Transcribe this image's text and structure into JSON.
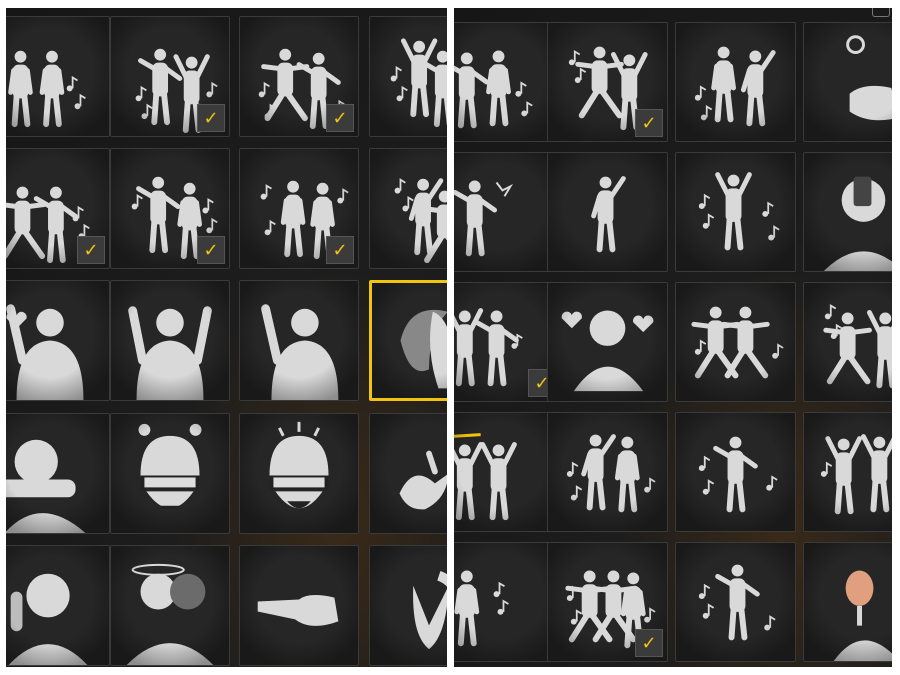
{
  "colors": {
    "accent": "#f1c40f",
    "tile_bg": "#262626",
    "figure": "#d9d9d9"
  },
  "panels": [
    {
      "name": "left",
      "rows": [
        [
          {
            "icon": "duo-dance-emote-icon",
            "owned": false,
            "selected": false
          },
          {
            "icon": "duo-dance-music-emote-icon",
            "owned": true,
            "selected": false
          },
          {
            "icon": "kick-dance-emote-icon",
            "owned": true,
            "selected": false
          },
          {
            "icon": "group-dance-music-emote-icon",
            "owned": false,
            "selected": false
          }
        ],
        [
          {
            "icon": "crouch-dance-duo-emote-icon",
            "owned": true,
            "selected": false
          },
          {
            "icon": "stage-dance-duo-emote-icon",
            "owned": true,
            "selected": false
          },
          {
            "icon": "robot-dance-duo-emote-icon",
            "owned": true,
            "selected": false
          },
          {
            "icon": "kneel-dance-duo-emote-icon",
            "owned": false,
            "selected": false
          }
        ],
        [
          {
            "icon": "heart-wave-emote-icon",
            "owned": false,
            "selected": false
          },
          {
            "icon": "hands-up-emote-icon",
            "owned": false,
            "selected": false
          },
          {
            "icon": "wave-hello-emote-icon",
            "owned": false,
            "selected": false
          },
          {
            "icon": "hair-flip-emote-icon",
            "owned": false,
            "selected": true
          }
        ],
        [
          {
            "icon": "head-rest-emote-icon",
            "owned": false,
            "selected": false
          },
          {
            "icon": "angry-helmet-emote-icon",
            "owned": false,
            "selected": false
          },
          {
            "icon": "laughing-helmet-emote-icon",
            "owned": false,
            "selected": false
          },
          {
            "icon": "clap-hands-emote-icon",
            "owned": false,
            "selected": false
          }
        ],
        [
          {
            "icon": "facepalm-emote-icon",
            "owned": false,
            "selected": false
          },
          {
            "icon": "dizzy-turn-emote-icon",
            "owned": false,
            "selected": false
          },
          {
            "icon": "point-finger-emote-icon",
            "owned": false,
            "selected": false
          },
          {
            "icon": "pray-emote-icon",
            "owned": false,
            "selected": false
          }
        ]
      ]
    },
    {
      "name": "right",
      "rows": [
        [
          {
            "icon": "duo-walk-dance-emote-icon",
            "owned": false,
            "selected": false
          },
          {
            "icon": "split-jump-duo-emote-icon",
            "owned": true,
            "selected": false
          },
          {
            "icon": "duo-pose-music-emote-icon",
            "owned": false,
            "selected": false
          },
          {
            "icon": "coin-flip-emote-icon",
            "owned": false,
            "selected": false
          }
        ],
        [
          {
            "icon": "kick-impact-emote-icon",
            "owned": false,
            "selected": false
          },
          {
            "icon": "dab-emote-icon",
            "owned": false,
            "selected": false
          },
          {
            "icon": "solo-dance-music-emote-icon",
            "owned": false,
            "selected": false
          },
          {
            "icon": "selfie-phone-emote-icon",
            "owned": false,
            "selected": false
          }
        ],
        [
          {
            "icon": "lean-dance-duo-emote-icon",
            "owned": true,
            "selected": false
          },
          {
            "icon": "hug-hearts-emote-icon",
            "owned": false,
            "selected": false
          },
          {
            "icon": "arms-out-duo-emote-icon",
            "owned": false,
            "selected": false
          },
          {
            "icon": "lunge-duo-music-emote-icon",
            "owned": false,
            "selected": false
          }
        ],
        [
          {
            "icon": "glow-stick-duo-emote-icon",
            "owned": false,
            "selected": false
          },
          {
            "icon": "sway-duo-music-emote-icon",
            "owned": false,
            "selected": false
          },
          {
            "icon": "spin-solo-music-emote-icon",
            "owned": false,
            "selected": false
          },
          {
            "icon": "arms-up-duo-emote-icon",
            "owned": false,
            "selected": false
          }
        ],
        [
          {
            "icon": "step-solo-music-emote-icon",
            "owned": false,
            "selected": false
          },
          {
            "icon": "trio-dance-music-emote-icon",
            "owned": true,
            "selected": false
          },
          {
            "icon": "hop-solo-music-emote-icon",
            "owned": false,
            "selected": false
          },
          {
            "icon": "hand-mirror-emote-icon",
            "owned": false,
            "selected": false
          }
        ]
      ]
    }
  ],
  "check_glyph": "✓"
}
